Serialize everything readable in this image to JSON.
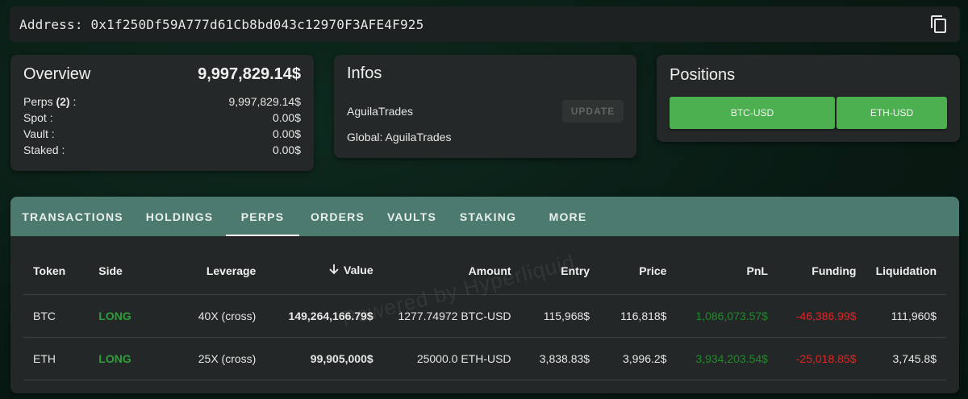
{
  "address": {
    "label": "Address: 0x1f250Df59A777d61Cb8bd043c12970F3AFE4F925",
    "copy_icon": "copy-icon"
  },
  "overview": {
    "title": "Overview",
    "total": "9,997,829.14$",
    "rows": [
      {
        "label_prefix": "Perps ",
        "label_bold": "(2)",
        "label_suffix": " :",
        "value": "9,997,829.14$"
      },
      {
        "label": "Spot :",
        "value": "0.00$"
      },
      {
        "label": "Vault :",
        "value": "0.00$"
      },
      {
        "label": "Staked :",
        "value": "0.00$"
      }
    ]
  },
  "infos": {
    "title": "Infos",
    "name": "AguilaTrades",
    "update_label": "UPDATE",
    "global": "Global: AguilaTrades"
  },
  "positions": {
    "title": "Positions",
    "buttons": [
      "BTC-USD",
      "ETH-USD"
    ],
    "button_color": "#4caf50"
  },
  "tabs": [
    "TRANSACTIONS",
    "HOLDINGS",
    "PERPS",
    "ORDERS",
    "VAULTS",
    "STAKING",
    "MORE"
  ],
  "active_tab": "PERPS",
  "table": {
    "headers": [
      "Token",
      "Side",
      "Leverage",
      "Value",
      "Amount",
      "Entry",
      "Price",
      "PnL",
      "Funding",
      "Liquidation"
    ],
    "sort_icon": "arrow-down-icon",
    "rows": [
      {
        "token": "BTC",
        "side": "LONG",
        "leverage": "40X (cross)",
        "value": "149,264,166.79$",
        "amount": "1277.74972 BTC-USD",
        "entry": "115,968$",
        "price": "116,818$",
        "pnl": "1,086,073.57$",
        "funding": "-46,386.99$",
        "liquidation": "111,960$"
      },
      {
        "token": "ETH",
        "side": "LONG",
        "leverage": "25X (cross)",
        "value": "99,905,000$",
        "amount": "25000.0 ETH-USD",
        "entry": "3,838.83$",
        "price": "3,996.2$",
        "pnl": "3,934,203.54$",
        "funding": "-25,018.85$",
        "liquidation": "3,745.8$"
      }
    ]
  },
  "watermark": "Powered by Hyperliquid",
  "colors": {
    "long": "#2e9e3a",
    "pnl": "#1f8a2a",
    "funding": "#e02424",
    "tab_bg": "#4c7a6f"
  }
}
